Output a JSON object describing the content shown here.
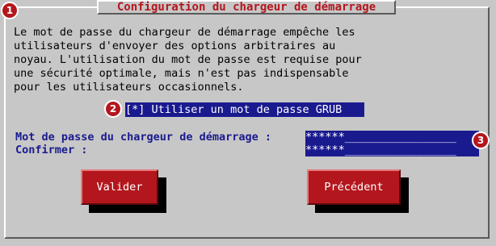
{
  "dialog": {
    "title": "Configuration du chargeur de démarrage",
    "description": "Le mot de passe du chargeur de démarrage empêche les\nutilisateurs d'envoyer des options arbitraires au\nnoyau. L'utilisation du mot de passe est requise pour\nune sécurité optimale, mais n'est pas indispensable\npour les utilisateurs occasionnels.",
    "checkbox_mark": "[*]",
    "checkbox_label": "Utiliser un mot de passe GRUB",
    "password_label": "Mot de passe du chargeur de démarrage :",
    "password_value": "******",
    "confirm_label": "Confirmer :",
    "confirm_value": "******",
    "ok_button": "Valider",
    "back_button": "Précédent"
  },
  "callouts": [
    "1",
    "2",
    "3"
  ],
  "colors": {
    "background": "#c7c7c7",
    "title": "#b3171d",
    "highlight": "#1a1a8f",
    "button": "#b3171d"
  }
}
